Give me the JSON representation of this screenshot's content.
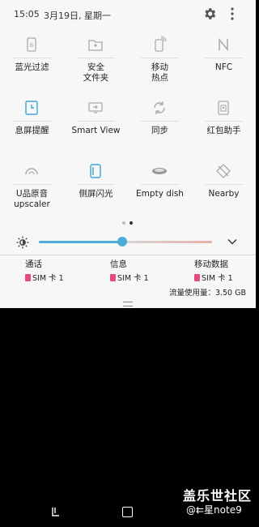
{
  "status": {
    "time": "15:05",
    "date": "3月19日, 星期一"
  },
  "tiles": [
    {
      "label": "蓝光过滤",
      "icon": "blue-light-filter-icon",
      "active": false
    },
    {
      "label": "安全\n文件夹",
      "icon": "secure-folder-icon",
      "active": false
    },
    {
      "label": "移动\n热点",
      "icon": "mobile-hotspot-icon",
      "active": false
    },
    {
      "label": "NFC",
      "icon": "nfc-icon",
      "active": false
    },
    {
      "label": "息屏提醒",
      "icon": "always-on-display-icon",
      "active": true
    },
    {
      "label": "Smart View",
      "icon": "smart-view-icon",
      "active": false
    },
    {
      "label": "同步",
      "icon": "sync-icon",
      "active": false
    },
    {
      "label": "红包助手",
      "icon": "red-envelope-icon",
      "active": false
    },
    {
      "label": "U品原音\nupscaler",
      "icon": "uhq-upscaler-icon",
      "active": false
    },
    {
      "label": "侧屏闪光",
      "icon": "edge-lighting-icon",
      "active": true
    },
    {
      "label": "Empty dish",
      "icon": "empty-dish-icon",
      "active": false
    },
    {
      "label": "Nearby",
      "icon": "nearby-icon",
      "active": false
    }
  ],
  "brightness": {
    "level": 0.48
  },
  "usage": {
    "items": [
      {
        "label": "通话",
        "sim": "SIM 卡 1"
      },
      {
        "label": "信息",
        "sim": "SIM 卡 1"
      },
      {
        "label": "移动数据",
        "sim": "SIM 卡 1"
      }
    ],
    "data_used": "流量使用量：3.50 GB"
  },
  "watermark": {
    "line1": "盖乐世社区",
    "line2": "@⇇星note9"
  },
  "colors": {
    "accent": "#4aaed6",
    "sim_badge": "#e54b7a"
  }
}
